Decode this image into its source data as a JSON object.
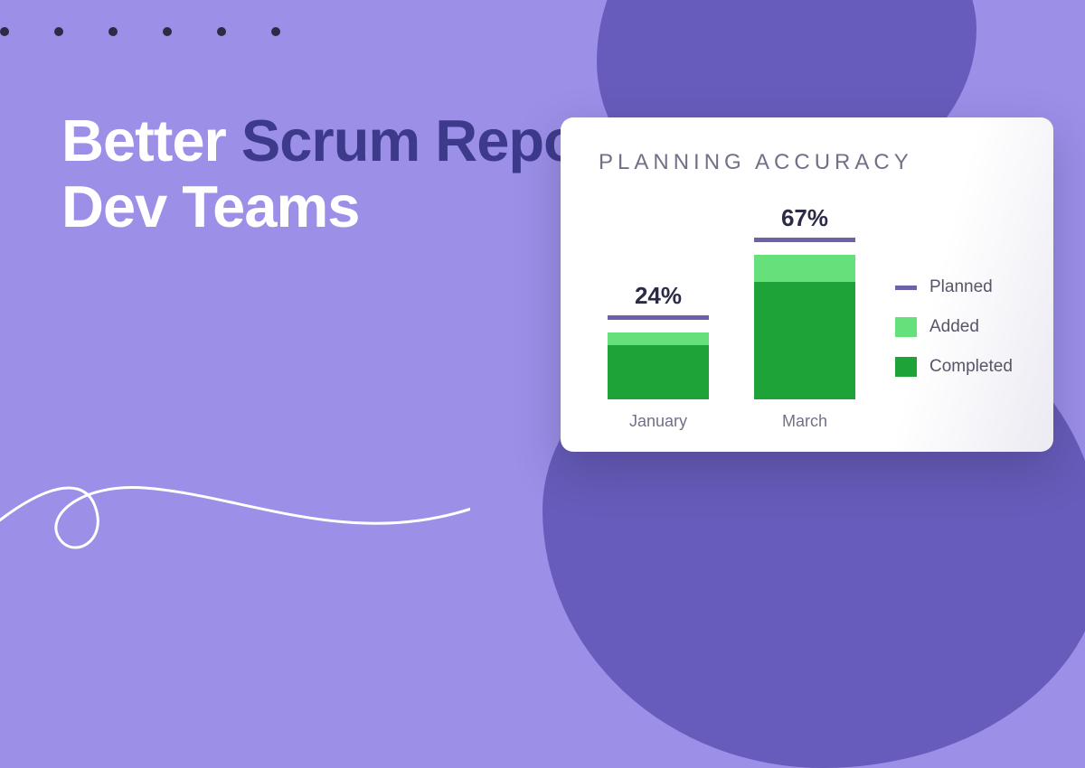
{
  "headline": {
    "part1": "Better ",
    "accent": "Scrum Reporting",
    "part2": " for Modern Dev Teams"
  },
  "card": {
    "title": "PLANNING ACCURACY"
  },
  "legend": {
    "planned": "Planned",
    "added": "Added",
    "completed": "Completed"
  },
  "chart_data": {
    "type": "bar",
    "title": "PLANNING ACCURACY",
    "categories": [
      "January",
      "March"
    ],
    "percent_labels": [
      "24%",
      "67%"
    ],
    "series": [
      {
        "name": "Completed",
        "values": [
          60,
          130
        ]
      },
      {
        "name": "Added",
        "values": [
          14,
          30
        ]
      }
    ],
    "planned_line": true,
    "colors": {
      "planned": "#6B63A8",
      "added": "#65E07A",
      "completed": "#1EA338"
    }
  }
}
